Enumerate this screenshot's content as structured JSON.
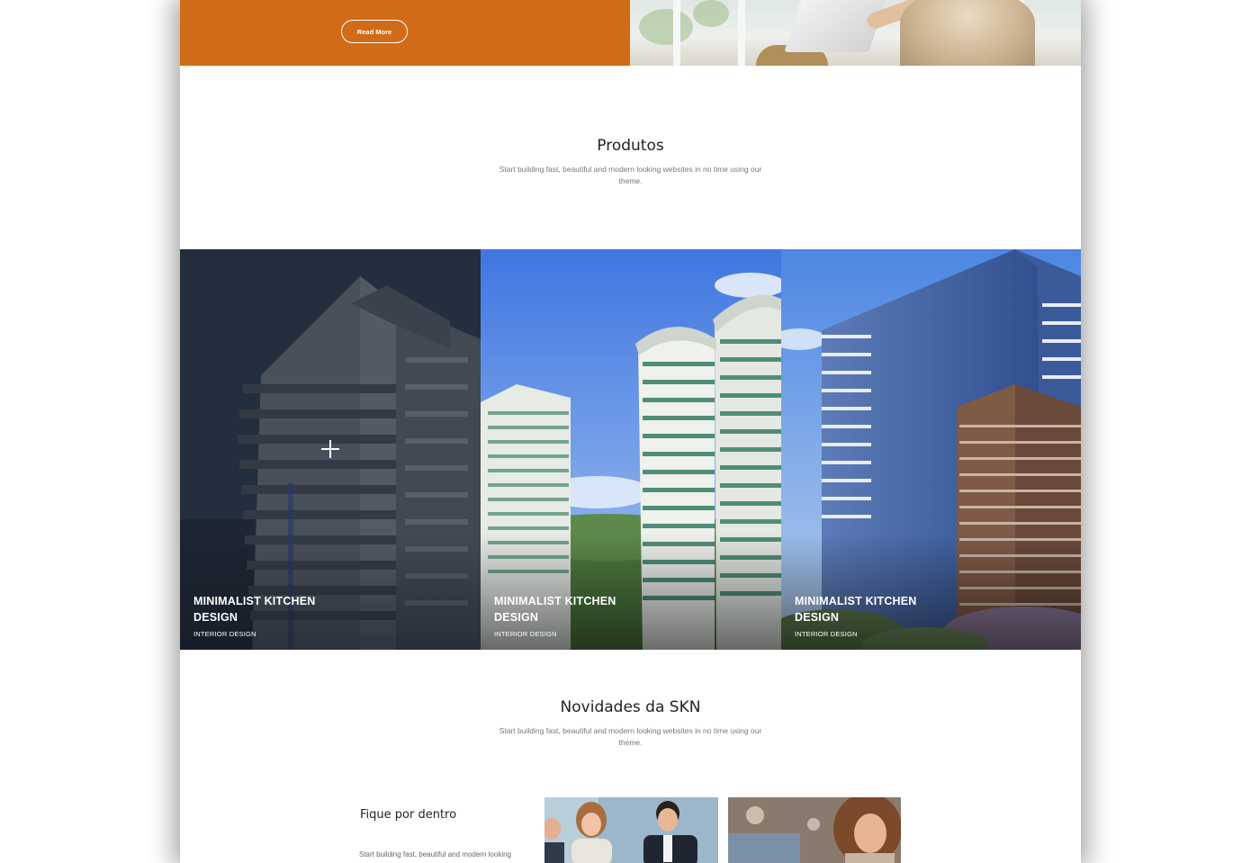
{
  "hero": {
    "read_more_label": "Read More",
    "accent_color": "#d26b17"
  },
  "products_section": {
    "title": "Produtos",
    "subtitle": "Start building fast, beautiful and modern looking websites in no time using our theme."
  },
  "products": [
    {
      "title": "MINIMALIST KITCHEN DESIGN",
      "category": "INTERIOR DESIGN",
      "hover": true
    },
    {
      "title": "MINIMALIST KITCHEN DESIGN",
      "category": "INTERIOR DESIGN",
      "hover": false
    },
    {
      "title": "MINIMALIST KITCHEN DESIGN",
      "category": "INTERIOR DESIGN",
      "hover": false
    }
  ],
  "news_section": {
    "title": "Novidades da SKN",
    "subtitle": "Start building fast, beautiful and modern looking websites in no time using our theme."
  },
  "news": {
    "block_title": "Fique por dentro",
    "block_text": "Start building fast, beautiful and modern looking"
  },
  "icons": {
    "hover_icon": "plus-icon"
  }
}
